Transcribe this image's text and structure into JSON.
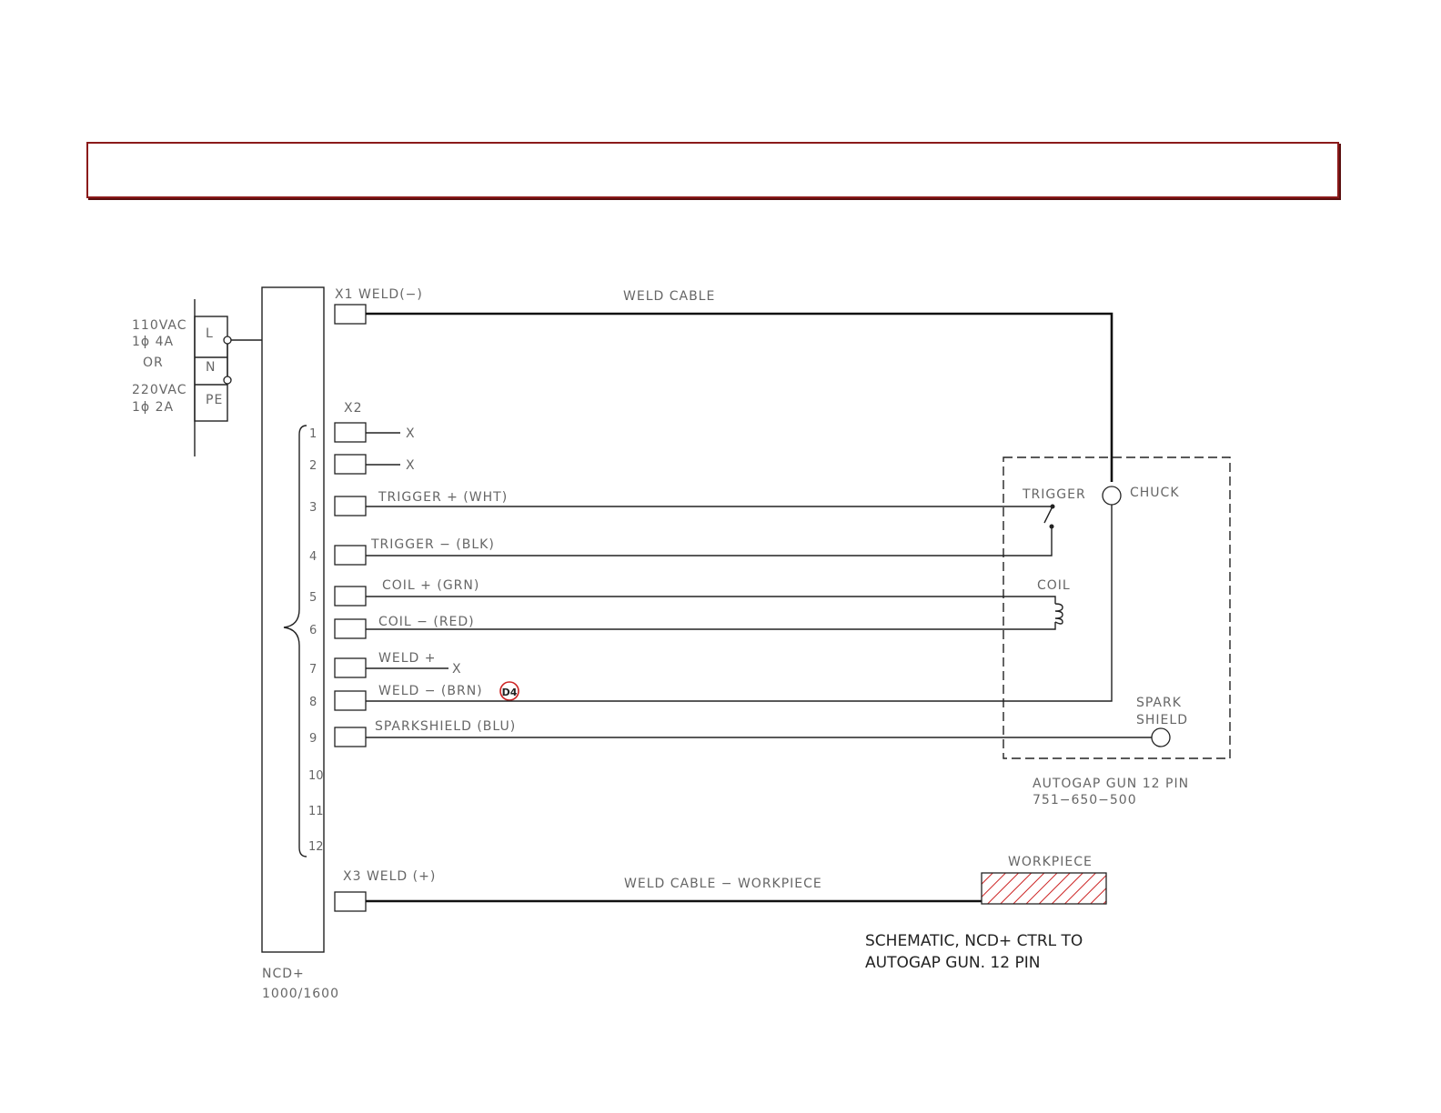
{
  "power": {
    "l1": "110VAC",
    "l2": "1ϕ  4A",
    "or": "OR",
    "l3": "220VAC",
    "l4": "1ϕ  2A",
    "L": "L",
    "N": "N",
    "PE": "PE"
  },
  "controller": {
    "name": "NCD+",
    "model": "1000/1600"
  },
  "x1": {
    "label": "X1  WELD(−)",
    "cable": "WELD  CABLE"
  },
  "x2": {
    "label": "X2"
  },
  "x3": {
    "label": "X3  WELD  (+)",
    "cable": "WELD  CABLE  −  WORKPIECE"
  },
  "pins": [
    "1",
    "2",
    "3",
    "4",
    "5",
    "6",
    "7",
    "8",
    "9",
    "10",
    "11",
    "12"
  ],
  "wires": {
    "nc": "X",
    "trig_p": "TRIGGER  +  (WHT)",
    "trig_m": "TRIGGER  −  (BLK)",
    "coil_p": "COIL  +  (GRN)",
    "coil_m": "COIL  −  (RED)",
    "weld_p": "WELD  +",
    "weld_m": "WELD  −  (BRN)",
    "spark": "SPARKSHIELD  (BLU)"
  },
  "marker": "D4",
  "gun": {
    "trigger": "TRIGGER",
    "chuck": "CHUCK",
    "coil": "COIL",
    "spark1": "SPARK",
    "spark2": "SHIELD",
    "name": "AUTOGAP  GUN  12  PIN",
    "part": "751−650−500"
  },
  "workpiece": "WORKPIECE",
  "caption": {
    "line1": "SCHEMATIC, NCD+ CTRL TO",
    "line2": "AUTOGAP GUN. 12 PIN"
  },
  "colors": {
    "title_border": "#8b1a1a",
    "marker": "#cc2222",
    "hatch": "#cc2222"
  }
}
